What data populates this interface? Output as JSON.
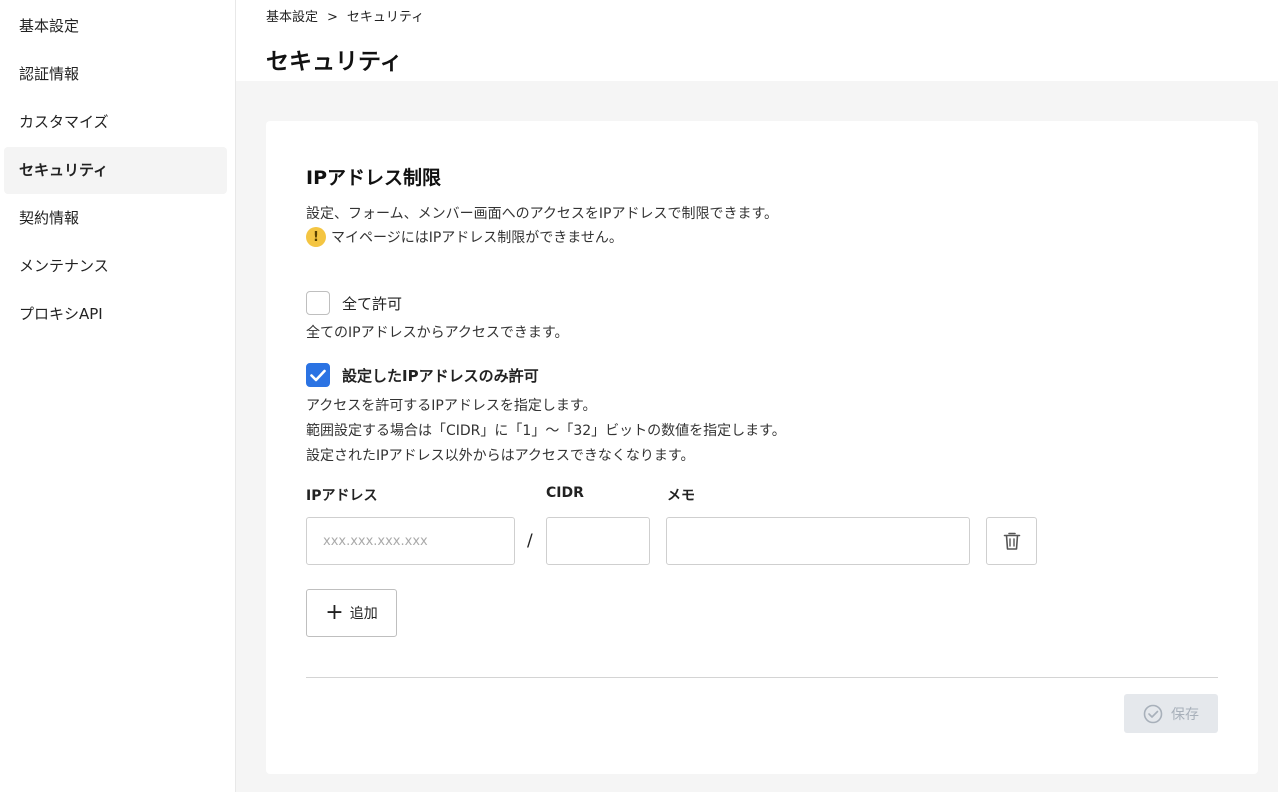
{
  "sidebar": {
    "items": [
      {
        "label": "基本設定"
      },
      {
        "label": "認証情報"
      },
      {
        "label": "カスタマイズ"
      },
      {
        "label": "セキュリティ",
        "active": true
      },
      {
        "label": "契約情報"
      },
      {
        "label": "メンテナンス"
      },
      {
        "label": "プロキシAPI"
      }
    ]
  },
  "header": {
    "breadcrumb": [
      "基本設定",
      ">",
      "セキュリティ"
    ],
    "title": "セキュリティ"
  },
  "ip_restriction": {
    "title": "IPアドレス制限",
    "description": "設定、フォーム、メンバー画面へのアクセスをIPアドレスで制限できます。",
    "warning": "マイページにはIPアドレス制限ができません。",
    "warning_icon": "warning-icon",
    "option_all": {
      "label": "全て許可",
      "checked": false,
      "description": "全てのIPアドレスからアクセスできます。"
    },
    "option_specified": {
      "label": "設定したIPアドレスのみ許可",
      "checked": true,
      "description_lines": [
        "アクセスを許可するIPアドレスを指定します。",
        "範囲設定する場合は「CIDR」に「1」〜「32」ビットの数値を指定します。",
        "設定されたIPアドレス以外からはアクセスできなくなります。"
      ]
    },
    "fields": {
      "ip_label": "IPアドレス",
      "ip_placeholder": "xxx.xxx.xxx.xxx",
      "ip_value": "",
      "slash": "/",
      "cidr_label": "CIDR",
      "cidr_value": "",
      "memo_label": "メモ",
      "memo_value": ""
    },
    "add_button": "追加",
    "save_button": "保存",
    "colors": {
      "accent": "#2b73e3",
      "warning": "#f4c542",
      "save_disabled_bg": "#e5e8ec",
      "save_disabled_text": "#a8b0ba"
    }
  }
}
